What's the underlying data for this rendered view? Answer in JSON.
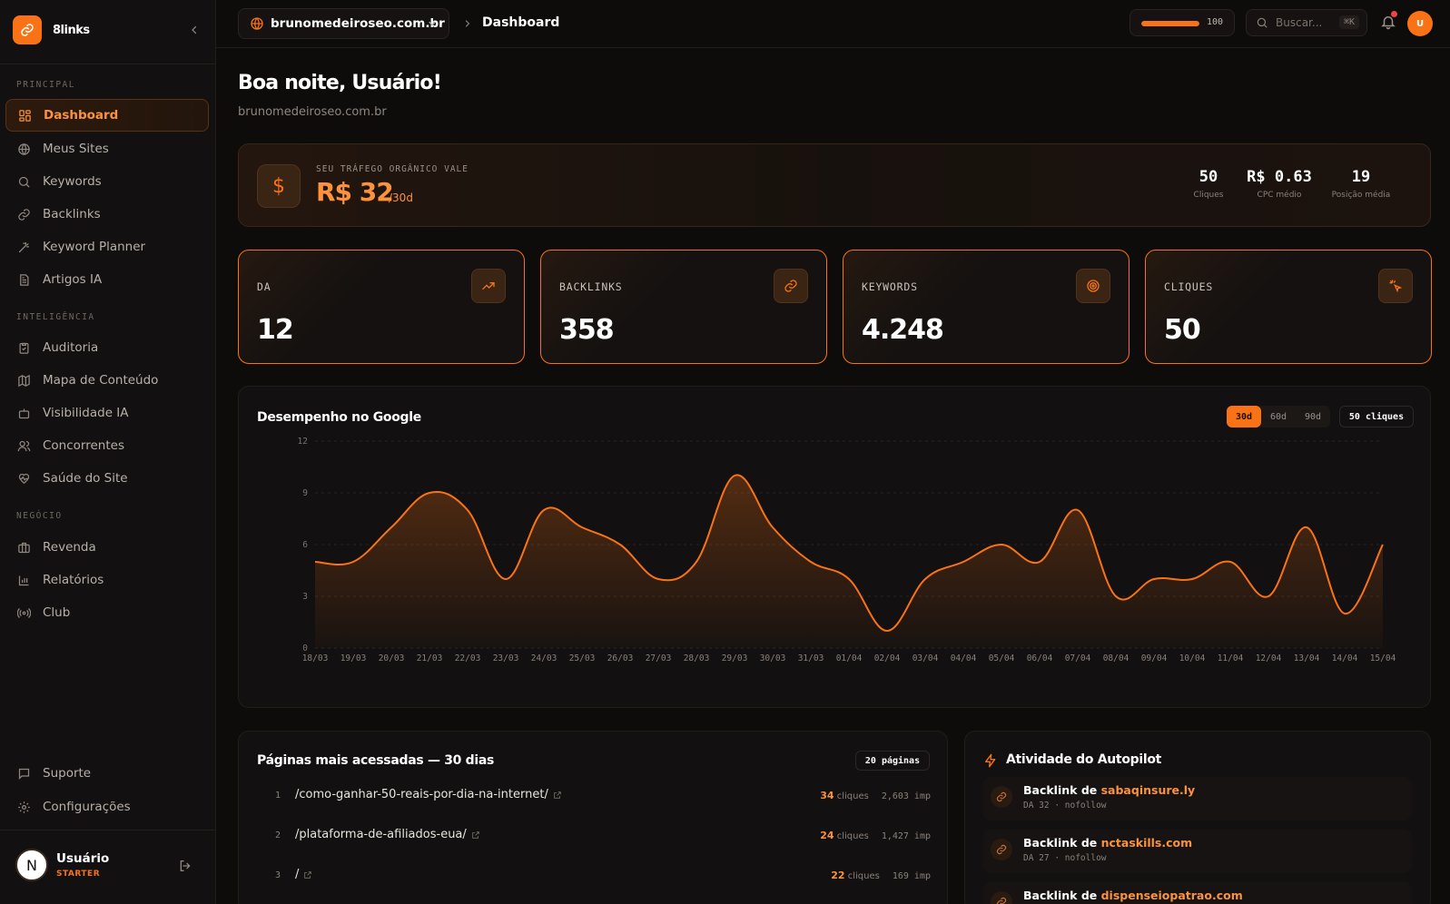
{
  "brand": {
    "name": "8links",
    "color": "#f97316"
  },
  "sidebar": {
    "sections": [
      {
        "label": "PRINCIPAL"
      },
      {
        "label": "INTELIGÊNCIA"
      },
      {
        "label": "NEGÓCIO"
      }
    ],
    "items": [
      {
        "label": "Dashboard",
        "icon": "grid-icon",
        "active": true
      },
      {
        "label": "Meus Sites",
        "icon": "globe-icon"
      },
      {
        "label": "Keywords",
        "icon": "search-icon"
      },
      {
        "label": "Backlinks",
        "icon": "link-icon"
      },
      {
        "label": "Keyword Planner",
        "icon": "wand-icon"
      },
      {
        "label": "Artigos IA",
        "icon": "document-icon"
      },
      {
        "label": "Auditoria",
        "icon": "clipboard-icon"
      },
      {
        "label": "Mapa de Conteúdo",
        "icon": "map-icon"
      },
      {
        "label": "Visibilidade IA",
        "icon": "bot-icon"
      },
      {
        "label": "Concorrentes",
        "icon": "users-icon"
      },
      {
        "label": "Saúde do Site",
        "icon": "heart-pulse-icon"
      },
      {
        "label": "Revenda",
        "icon": "briefcase-icon"
      },
      {
        "label": "Relatórios",
        "icon": "bar-chart-icon"
      },
      {
        "label": "Club",
        "icon": "radio-icon"
      }
    ],
    "bottom_items": [
      {
        "label": "Suporte",
        "icon": "message-icon"
      },
      {
        "label": "Configurações",
        "icon": "gear-icon"
      }
    ],
    "user": {
      "initial": "N",
      "name": "Usuário",
      "plan": "STARTER"
    }
  },
  "topbar": {
    "site": "brunomedeiroseo.com.br",
    "breadcrumb": "Dashboard",
    "credits": {
      "value": "100",
      "fill_fraction": 1.0
    },
    "search": {
      "placeholder": "Buscar...",
      "shortcut": "⌘K"
    },
    "avatar": "U"
  },
  "greeting": {
    "title": "Boa noite, Usuário!",
    "subtitle": "brunomedeiroseo.com.br"
  },
  "traffic": {
    "label": "SEU TRÁFEGO ORGÂNICO VALE",
    "value": "R$ 32",
    "period": "/30d",
    "stats": [
      {
        "value": "50",
        "label": "Cliques"
      },
      {
        "value": "R$ 0.63",
        "label": "CPC médio"
      },
      {
        "value": "19",
        "label": "Posição média"
      }
    ]
  },
  "metrics": [
    {
      "label": "DA",
      "value": "12",
      "icon": "trending-up-icon"
    },
    {
      "label": "BACKLINKS",
      "value": "358",
      "icon": "link-icon"
    },
    {
      "label": "KEYWORDS",
      "value": "4.248",
      "icon": "target-icon"
    },
    {
      "label": "CLIQUES",
      "value": "50",
      "icon": "pointer-click-icon"
    }
  ],
  "performance": {
    "title": "Desempenho no Google",
    "ranges": [
      "30d",
      "60d",
      "90d"
    ],
    "active_range": "30d",
    "clicks_pill": "50 cliques"
  },
  "chart_data": {
    "type": "area",
    "x": [
      "18/03",
      "19/03",
      "20/03",
      "21/03",
      "22/03",
      "23/03",
      "24/03",
      "25/03",
      "26/03",
      "27/03",
      "28/03",
      "29/03",
      "30/03",
      "31/03",
      "01/04",
      "02/04",
      "03/04",
      "04/04",
      "05/04",
      "06/04",
      "07/04",
      "08/04",
      "09/04",
      "10/04",
      "11/04",
      "12/04",
      "13/04",
      "14/04",
      "15/04"
    ],
    "values": [
      5,
      5,
      7,
      9,
      8,
      4,
      8,
      7,
      6,
      4,
      5,
      10,
      7,
      5,
      4,
      1,
      4,
      5,
      6,
      5,
      8,
      3,
      4,
      4,
      5,
      3,
      7,
      2,
      6
    ],
    "ylim": [
      0,
      12
    ],
    "yticks": [
      0,
      3,
      6,
      9,
      12
    ],
    "grid": true,
    "color": "#f97316"
  },
  "pages": {
    "title": "Páginas mais acessadas — 30 dias",
    "count": "20 páginas",
    "clicks_unit": "cliques",
    "rows": [
      {
        "rank": "1",
        "path": "/como-ganhar-50-reais-por-dia-na-internet/",
        "clicks": "34",
        "impressions": "2,603 imp"
      },
      {
        "rank": "2",
        "path": "/plataforma-de-afiliados-eua/",
        "clicks": "24",
        "impressions": "1,427 imp"
      },
      {
        "rank": "3",
        "path": "/",
        "clicks": "22",
        "impressions": "169 imp"
      }
    ]
  },
  "autopilot": {
    "title": "Atividade do Autopilot",
    "prefix": "Backlink de",
    "rows": [
      {
        "domain": "sabaqinsure.ly",
        "meta": "DA 32 · nofollow"
      },
      {
        "domain": "nctaskills.com",
        "meta": "DA 27 · nofollow"
      },
      {
        "domain": "dispenseiopatrao.com",
        "meta": ""
      }
    ]
  }
}
